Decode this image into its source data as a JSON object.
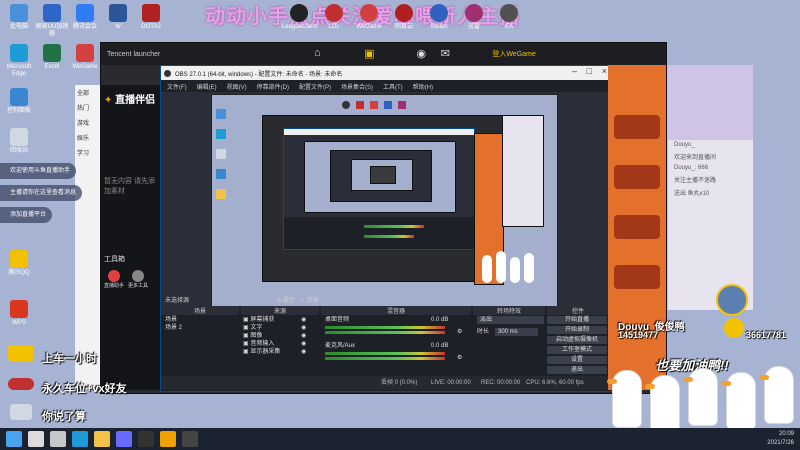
{
  "stream_title": "动动小手点点关注爱心喂新人主播",
  "desktop_icons": [
    {
      "label": "此电脑",
      "color": "#4a90d9"
    },
    {
      "label": "網易UU加速器",
      "color": "#2d66c8"
    },
    {
      "label": "腾讯会议",
      "color": "#2f7cf6"
    },
    {
      "label": "W",
      "color": "#2b579a"
    },
    {
      "label": "DOTA2",
      "color": "#b22222"
    },
    {
      "label": "Microsoft Edge",
      "color": "#1f9bd7"
    },
    {
      "label": "Excel",
      "color": "#217346"
    },
    {
      "label": "WeGame",
      "color": "#d43f3f"
    },
    {
      "label": "回收站",
      "color": "#cfd8e3"
    },
    {
      "label": "控制面板",
      "color": "#3a86d0"
    },
    {
      "label": "WPS",
      "color": "#d9381e"
    },
    {
      "label": "腾讯QQ",
      "color": "#f2c200"
    }
  ],
  "top_apps": [
    "LeagueClient",
    "LOL",
    "WeGame",
    "网易云",
    "Steam",
    "迅雷",
    "EA"
  ],
  "tencent_launcher": {
    "title": "Tencent launcher",
    "user": "登入WeGame"
  },
  "helper_app": {
    "logo": "直播伴侣",
    "section": "工具箱",
    "items": [
      "直播助手",
      "更多工具"
    ],
    "empty_hint": "暂无内容 请先添加素材"
  },
  "helper_side_list": [
    "全部",
    "热门",
    "游戏",
    "娱乐",
    "学习"
  ],
  "notifications": [
    "欢迎使用斗鱼直播助手",
    "主播请你在这里查看消息",
    "添加直播平台"
  ],
  "obs": {
    "title": "OBS 27.0.1 (64-bit, windows) - 配置文件: 未命名 - 场景: 未命名",
    "menu": [
      "文件(F)",
      "编辑(E)",
      "视图(V)",
      "停靠部件(D)",
      "配置文件(P)",
      "场景集合(S)",
      "工具(T)",
      "帮助(H)"
    ],
    "scene_label": "未选择源",
    "props_btn": "属性",
    "filter_btn": "滤镜",
    "docks": {
      "scenes": "场景",
      "sources": "来源",
      "mixer": "混音器",
      "transitions": "转场特效",
      "controls": "控件"
    },
    "scenes": [
      "场景",
      "场景 2"
    ],
    "sources": [
      "屏幕捕获",
      "文字",
      "图像",
      "音频输入",
      "显示器采集"
    ],
    "mixer": [
      {
        "name": "桌面音频",
        "db": "0.0 dB"
      },
      {
        "name": "麦克风/Aux",
        "db": "0.0 dB"
      }
    ],
    "transition": {
      "type": "淡出",
      "duration_label": "时长",
      "duration": "300 ms"
    },
    "controls": [
      "开始直播",
      "开始录制",
      "启动虚拟摄像机",
      "工作室模式",
      "设置",
      "退出"
    ],
    "status": {
      "fps": "CPU: 6.6%, 60.00 fps",
      "live": "LIVE: 00:00:00",
      "rec": "REC: 00:00:00",
      "dropped": "丢帧 0 (0.0%)"
    }
  },
  "chat": {
    "room": "Douyu_",
    "lines": [
      "欢迎来到直播间",
      "Douyu_: 666",
      "关注主播不迷路",
      "送出 鱼丸x10"
    ]
  },
  "overlays": {
    "badge_name": "Douyu_俊俊鸭",
    "badge_sub": "14519477",
    "id_number": "36617781",
    "cheer": "也要加油鸭!!",
    "rank_lines": [
      "上车一小时",
      "永久车位+vx好友",
      "你说了算"
    ]
  },
  "taskbar": {
    "time": "20:09",
    "date": "2021/7/26",
    "items": [
      {
        "name": "start",
        "color": "#4aa3f0"
      },
      {
        "name": "search",
        "color": "#dcdcdc"
      },
      {
        "name": "task-view",
        "color": "#c8c8c8"
      },
      {
        "name": "edge",
        "color": "#1f9bd7"
      },
      {
        "name": "folder",
        "color": "#f2c24b"
      },
      {
        "name": "store",
        "color": "#6a6aff"
      },
      {
        "name": "wegame",
        "color": "#333333"
      },
      {
        "name": "helper",
        "color": "#f0a000"
      },
      {
        "name": "obs",
        "color": "#444444"
      }
    ]
  }
}
